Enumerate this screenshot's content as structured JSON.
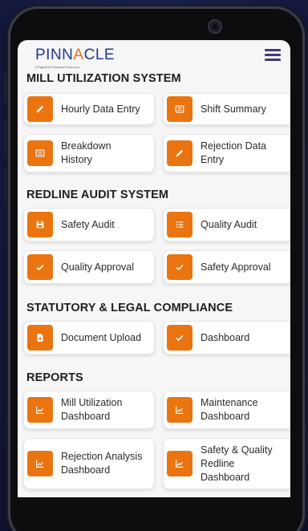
{
  "brand": {
    "name_pre": "PINN",
    "name_accent": "A",
    "name_post": "CLE",
    "tagline": "#TogetherTowardsTomorrow"
  },
  "colors": {
    "accent": "#ea7410",
    "brand_blue": "#243a8c",
    "menu": "#3f3a7a"
  },
  "sections": [
    {
      "title": "MILL UTILIZATION SYSTEM",
      "items": [
        {
          "label": "Hourly Data Entry",
          "icon": "pencil-icon"
        },
        {
          "label": "Shift Summary",
          "icon": "list-icon"
        },
        {
          "label": "Breakdown History",
          "icon": "list-icon"
        },
        {
          "label": "Rejection Data Entry",
          "icon": "pencil-icon"
        }
      ]
    },
    {
      "title": "REDLINE AUDIT SYSTEM",
      "items": [
        {
          "label": "Safety Audit",
          "icon": "save-icon"
        },
        {
          "label": "Quality Audit",
          "icon": "bulleted-list-icon"
        },
        {
          "label": "Quality Approval",
          "icon": "check-icon"
        },
        {
          "label": "Safety Approval",
          "icon": "check-icon"
        }
      ]
    },
    {
      "title": "STATUTORY & LEGAL COMPLIANCE",
      "items": [
        {
          "label": "Document Upload",
          "icon": "file-upload-icon"
        },
        {
          "label": "Dashboard",
          "icon": "check-icon"
        }
      ]
    },
    {
      "title": "REPORTS",
      "items": [
        {
          "label": "Mill Utilization Dashboard",
          "icon": "line-chart-icon"
        },
        {
          "label": "Maintenance Dashboard",
          "icon": "line-chart-icon"
        },
        {
          "label": "Rejection Analysis Dashboard",
          "icon": "line-chart-icon"
        },
        {
          "label": "Safety & Quality Redline Dashboard",
          "icon": "line-chart-icon"
        }
      ]
    }
  ]
}
